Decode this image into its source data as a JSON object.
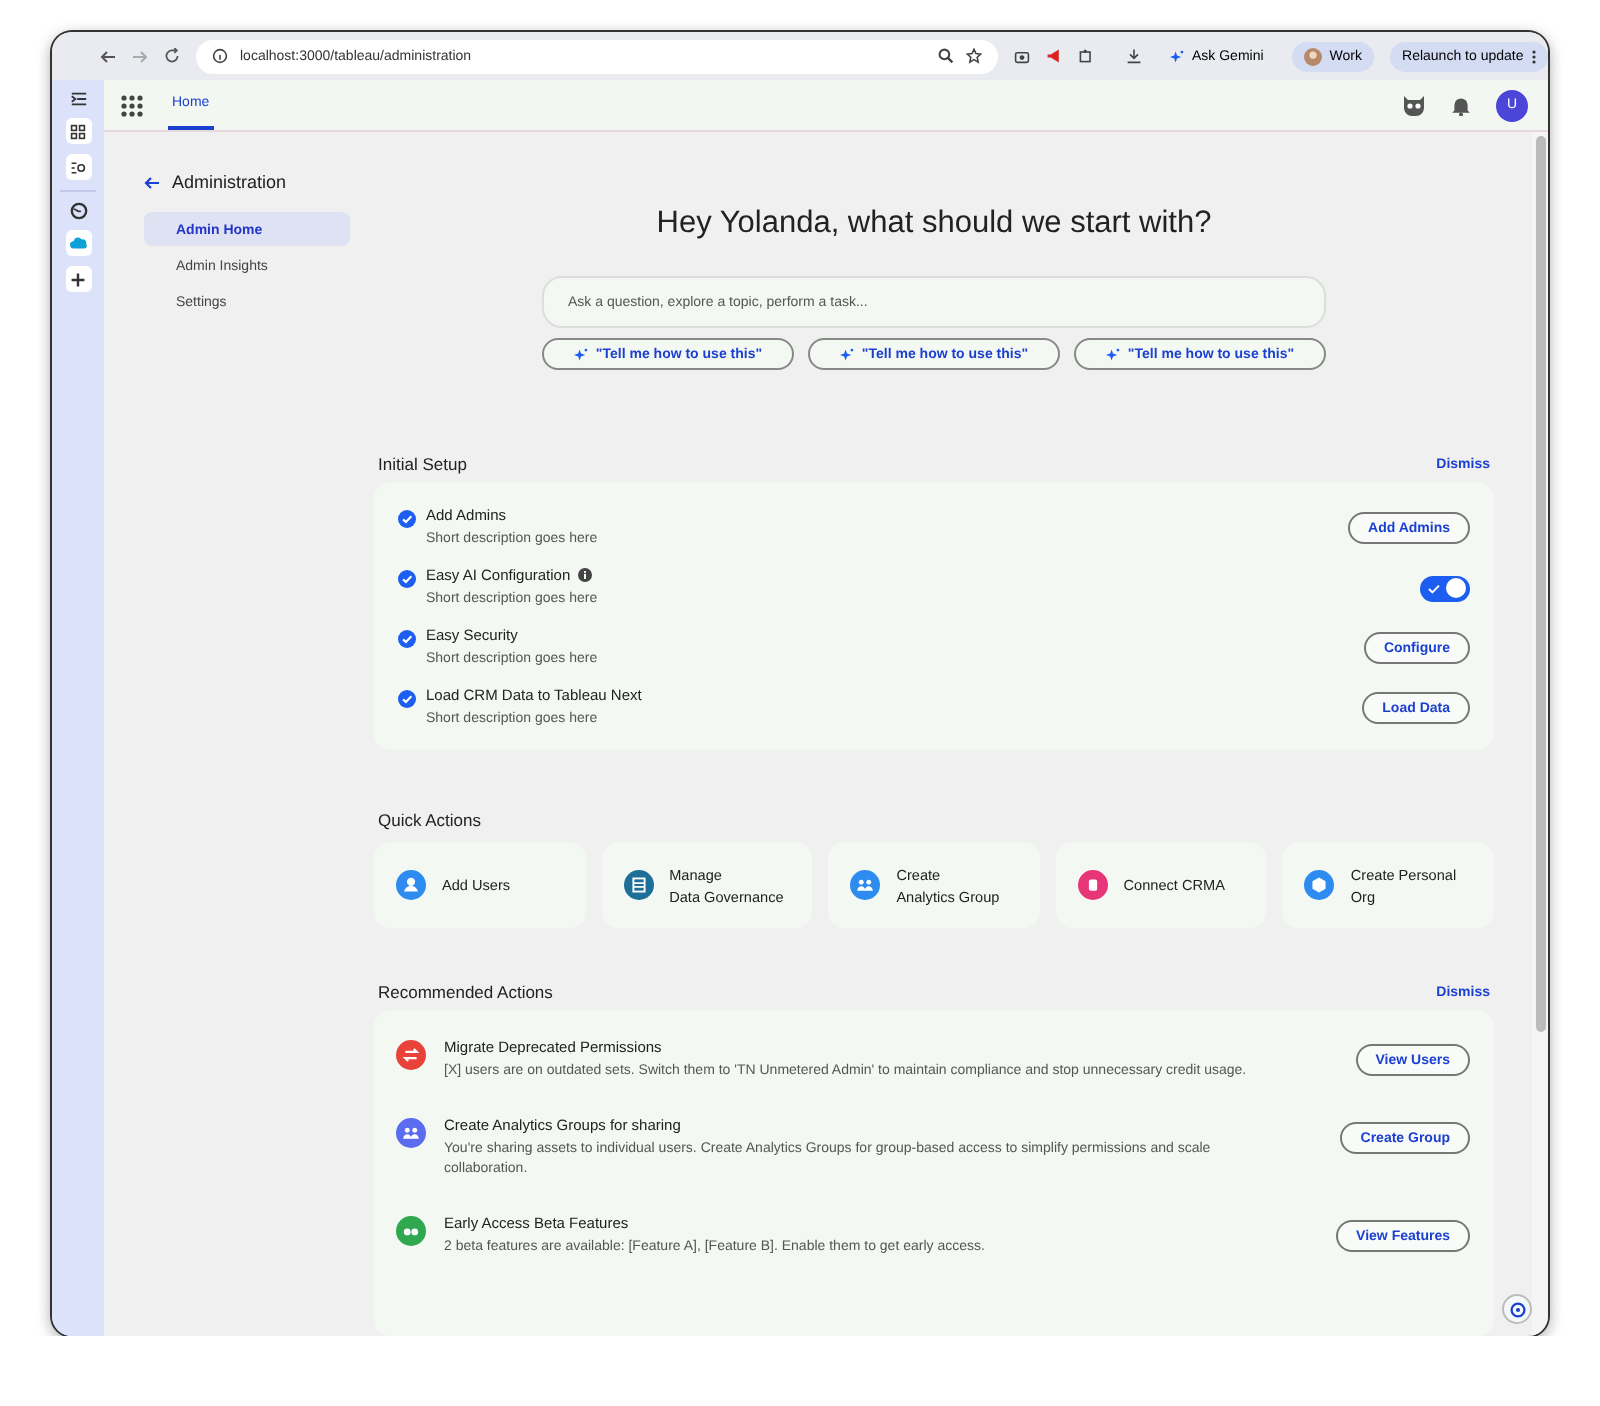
{
  "browser": {
    "url": "localhost:3000/tableau/administration",
    "assistant": "Ask Gemini",
    "profile": "Work",
    "relaunch": "Relaunch to update"
  },
  "app_header": {
    "tabs": [
      {
        "label": "Home",
        "selected": true
      }
    ],
    "avatar": "U"
  },
  "sidebar": {
    "title": "Administration",
    "items": [
      {
        "label": "Admin Home",
        "selected": true
      },
      {
        "label": "Admin Insights",
        "selected": false
      },
      {
        "label": "Settings",
        "selected": false
      }
    ]
  },
  "hero": {
    "heading": "Hey Yolanda, what should we start with?",
    "search": {
      "placeholder": "Ask a question, explore a topic, perform a task..."
    },
    "suggestions": [
      "\"Tell me how to use this\"",
      "\"Tell me how to use this\"",
      "\"Tell me how to use this\""
    ]
  },
  "initial_setup": {
    "title": "Initial Setup",
    "dismiss": "Dismiss",
    "items": [
      {
        "title": "Add Admins",
        "description": "Short description goes here",
        "done": true,
        "info": false,
        "kind": "button",
        "action": "Add Admins"
      },
      {
        "title": "Easy AI Configuration",
        "description": "Short description goes here",
        "done": true,
        "info": true,
        "kind": "toggle",
        "on": true
      },
      {
        "title": "Easy Security",
        "description": "Short description goes here",
        "done": true,
        "info": false,
        "kind": "button",
        "action": "Configure"
      },
      {
        "title": "Load CRM Data to Tableau Next",
        "description": "Short description goes here",
        "done": true,
        "info": false,
        "kind": "button",
        "action": "Load Data"
      }
    ]
  },
  "quick_actions": {
    "title": "Quick Actions",
    "items": [
      {
        "label": "Add Users",
        "color": "#2e8cf0"
      },
      {
        "label": "Manage\nData Governance",
        "color": "#1d6e99"
      },
      {
        "label": "Create\nAnalytics Group",
        "color": "#2e8cf0"
      },
      {
        "label": "Connect CRMA",
        "color": "#e8357a"
      },
      {
        "label": "Create Personal\nOrg",
        "color": "#2e8cf0"
      }
    ]
  },
  "recommended": {
    "title": "Recommended Actions",
    "dismiss": "Dismiss",
    "items": [
      {
        "title": "Migrate Deprecated Permissions",
        "description": "[X] users are on outdated sets. Switch them to 'TN Unmetered Admin' to maintain compliance and stop unnecessary credit usage.",
        "color": "#e8423a",
        "action": "View Users"
      },
      {
        "title": "Create Analytics Groups for sharing",
        "description": "You're sharing assets to individual users. Create Analytics Groups for group-based access to simplify permissions and scale collaboration.",
        "color": "#5b6cf0",
        "action": "Create Group"
      },
      {
        "title": "Early Access Beta Features",
        "description": "2 beta features are available: [Feature A], [Feature B]. Enable them to get early access.",
        "color": "#2fa84f",
        "action": "View Features"
      }
    ]
  }
}
